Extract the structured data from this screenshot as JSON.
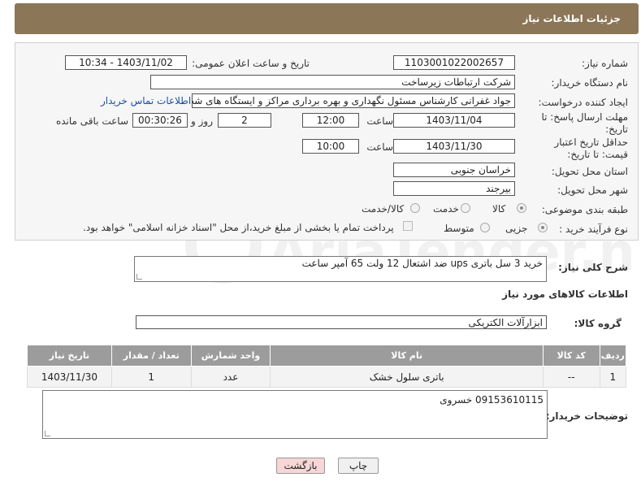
{
  "header": {
    "title": "جزئیات اطلاعات نیاز"
  },
  "form": {
    "need_number_label": "شماره نیاز:",
    "need_number": "1103001022002657",
    "announce_label": "تاریخ و ساعت اعلان عمومی:",
    "announce_value": "1403/11/02 - 10:34",
    "buyer_org_label": "نام دستگاه خریدار:",
    "buyer_org": "شرکت ارتباطات زیرساخت",
    "creator_label": "ایجاد کننده درخواست:",
    "creator": "جواد غفرانی کارشناس مسئول نگهداری و بهره برداری مراکز و ایستگاه های شب",
    "contact_link": "اطلاعات تماس خریدار",
    "deadline_label": "مهلت ارسال پاسخ: تا تاریخ:",
    "deadline_date": "1403/11/04",
    "time_label": "ساعت",
    "deadline_time": "12:00",
    "days": "2",
    "days_label": "روز و",
    "remaining": "00:30:26",
    "remaining_label": "ساعت باقی مانده",
    "validity_label": "حداقل تاریخ اعتبار قیمت: تا تاریخ:",
    "validity_date": "1403/11/30",
    "validity_time_label": "ساعت",
    "validity_time": "10:00",
    "province_label": "استان محل تحویل:",
    "province": "خراسان جنوبی",
    "city_label": "شهر محل تحویل:",
    "city": "بیرجند",
    "category_label": "طبقه بندی موضوعی:",
    "category_options": [
      "کالا",
      "خدمت",
      "کالا/خدمت"
    ],
    "process_label": "نوع فرآیند خرید :",
    "process_options": [
      "جزیی",
      "متوسط"
    ],
    "payment_note": "پرداخت تمام یا بخشی از مبلغ خرید،از محل \"اسناد خزانه اسلامی\" خواهد بود."
  },
  "summary": {
    "label": "شرح کلی نیاز:",
    "value": "خرید 3 سل باتری ups ضد اشتعال 12 ولت 65 آمپر ساعت"
  },
  "goods_section_title": "اطلاعات کالاهای مورد نیاز",
  "goods_group": {
    "label": "گروه کالا:",
    "value": "ابزارآلات الکتریکی"
  },
  "table": {
    "headers": [
      "ردیف",
      "کد کالا",
      "نام کالا",
      "واحد شمارش",
      "تعداد / مقدار",
      "تاریخ نیاز"
    ],
    "rows": [
      [
        "1",
        "--",
        "باتری سلول خشک",
        "عدد",
        "1",
        "1403/11/30"
      ]
    ]
  },
  "buyer_notes": {
    "label": "توضیحات خریدار:",
    "value": "09153610115 خسروی"
  },
  "buttons": {
    "print": "چاپ",
    "back": "بازگشت"
  },
  "watermark": "AriaTender.neT",
  "colors": {
    "header_bg": "#8b7657",
    "table_header": "#9c9c9c",
    "back_btn": "#f6d6d6",
    "print_btn": "#f0f0f0"
  }
}
